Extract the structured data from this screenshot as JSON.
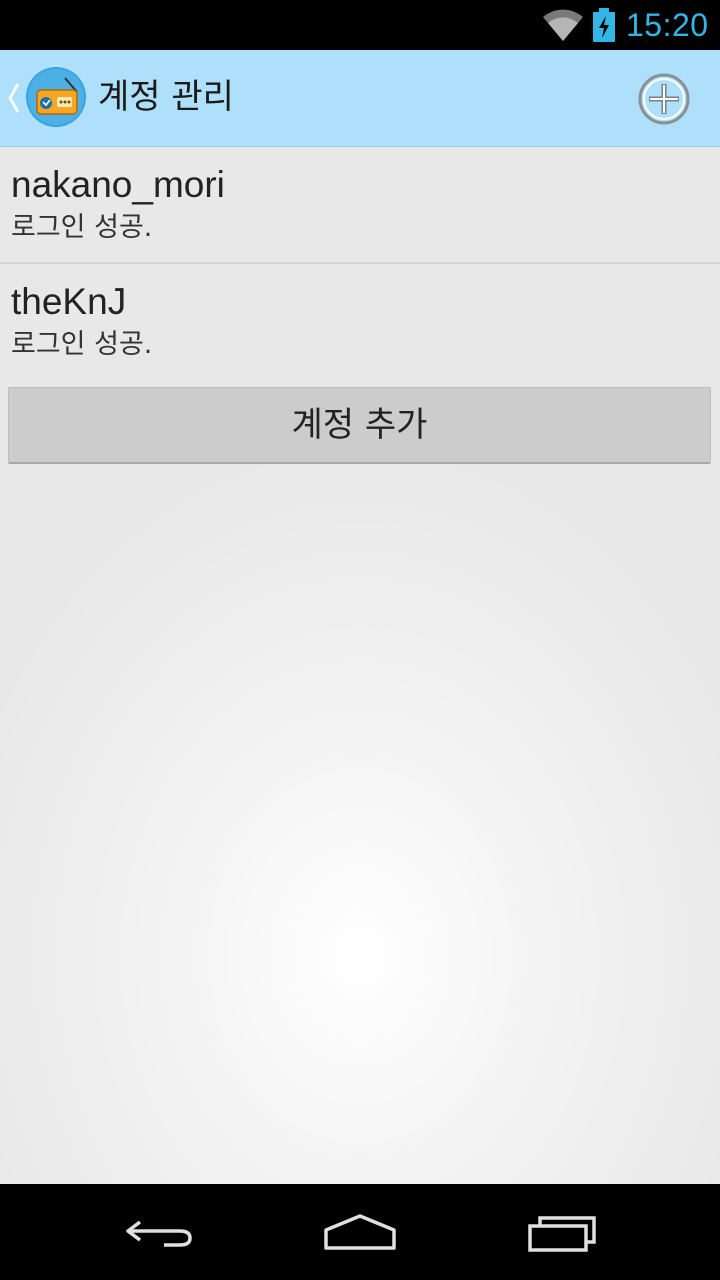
{
  "status_bar": {
    "time": "15:20",
    "icons": [
      "wifi-icon",
      "battery-charging-icon"
    ],
    "accent_color": "#33b5e5"
  },
  "action_bar": {
    "title": "계정 관리",
    "app_icon": "radio-app-icon",
    "action_icon": "add-circle-icon",
    "background_color": "#aee0fb"
  },
  "accounts": [
    {
      "name": "nakano_mori",
      "status": "로그인 성공."
    },
    {
      "name": "theKnJ",
      "status": "로그인 성공."
    }
  ],
  "add_account_button": {
    "label": "계정 추가"
  },
  "nav_bar": {
    "icons": [
      "back-icon",
      "home-icon",
      "recents-icon"
    ]
  }
}
